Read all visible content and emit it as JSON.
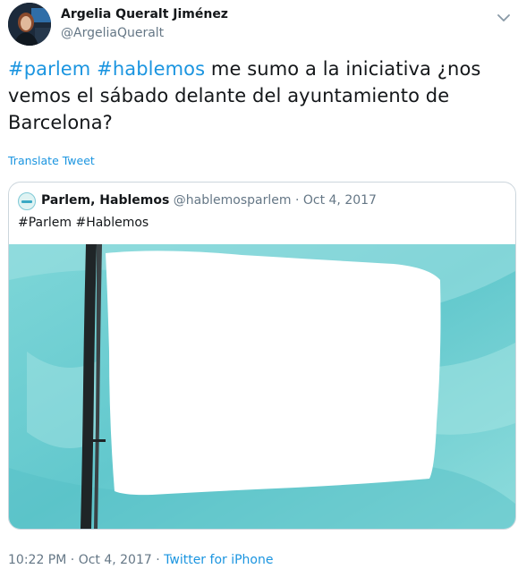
{
  "author": {
    "name": "Argelia Queralt Jiménez",
    "handle": "@ArgeliaQueralt"
  },
  "tweet": {
    "hashtag_1": "#parlem",
    "hashtag_2": "#hablemos",
    "text": " me sumo a la iniciativa ¿nos vemos el sábado delante del ayuntamiento de Barcelona?",
    "translate_label": "Translate Tweet"
  },
  "quote": {
    "name": "Parlem, Hablemos",
    "handle": "@hablemosparlem",
    "separator": "·",
    "date": "Oct 4, 2017",
    "text": "#Parlem #Hablemos"
  },
  "footer": {
    "time": "10:22 PM",
    "separator_1": "·",
    "date": "Oct 4, 2017",
    "separator_2": "·",
    "source": "Twitter for iPhone"
  },
  "colors": {
    "link": "#1b95e0",
    "secondary_text": "#657786",
    "image_background": "#6fcfd3"
  },
  "icons": {
    "menu": "chevron-down-icon"
  }
}
